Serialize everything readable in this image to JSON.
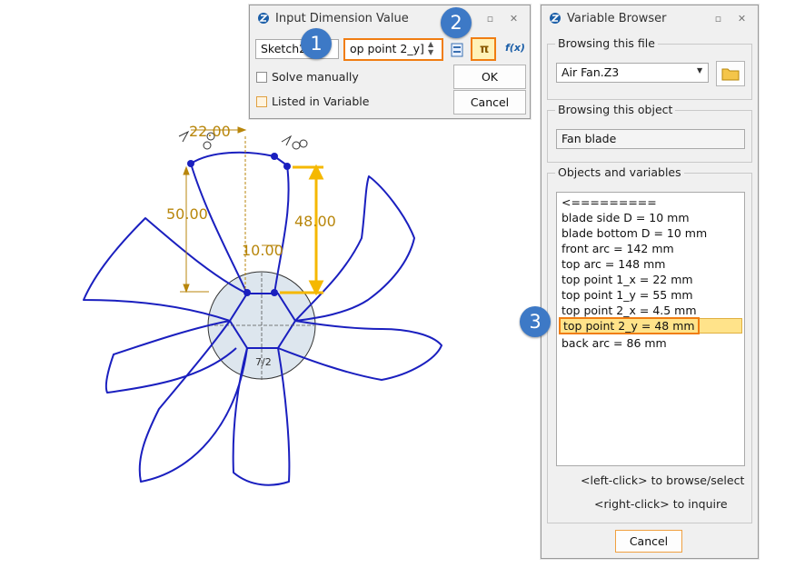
{
  "sketch": {
    "dim_width": "22.00",
    "dim_height_left": "50.00",
    "dim_height_right": "48.00",
    "dim_center": "10.00",
    "hub_label": "7/2"
  },
  "input_dialog": {
    "title": "Input Dimension Value",
    "sketch_field": "Sketch2_",
    "equals": "=",
    "value_field": "op point 2_y]",
    "solve_manually": "Solve manually",
    "listed_in_variable": "Listed in Variable",
    "ok": "OK",
    "cancel": "Cancel",
    "fx": "f(x)",
    "pi": "π"
  },
  "variable_browser": {
    "title": "Variable Browser",
    "browsing_file_label": "Browsing this file",
    "file_value": "Air Fan.Z3",
    "browsing_object_label": "Browsing this object",
    "object_value": "Fan blade",
    "objects_variables_label": "Objects and variables",
    "items": [
      "<=========",
      "blade side D = 10 mm",
      "blade bottom D = 10 mm",
      "front arc = 142 mm",
      "top arc = 148 mm",
      "top point 1_x = 22 mm",
      "top point 1_y = 55 mm",
      "top point 2_x = 4.5 mm",
      "top point 2_y = 48 mm",
      "back arc = 86 mm"
    ],
    "hint_left": "<left-click> to browse/select",
    "hint_right": "<right-click> to inquire",
    "cancel": "Cancel"
  },
  "badges": {
    "b1": "1",
    "b2": "2",
    "b3": "3"
  },
  "colors": {
    "sketch_blue": "#1a1fbf",
    "dimension_gold": "#b8860b",
    "highlight_orange": "#f07d12",
    "badge_blue": "#3d79c6",
    "selected_yellow": "#ffe38a"
  }
}
